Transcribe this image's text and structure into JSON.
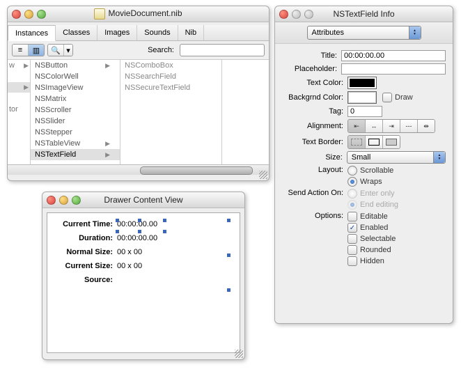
{
  "nib": {
    "title": "MovieDocument.nib",
    "tabs": [
      "Instances",
      "Classes",
      "Images",
      "Sounds",
      "Nib"
    ],
    "active_tab": 0,
    "search_label": "Search:",
    "col0": [
      "w",
      "",
      "",
      "tor",
      ""
    ],
    "col1": [
      {
        "label": "NSButton",
        "arrow": true
      },
      {
        "label": "NSColorWell",
        "arrow": false
      },
      {
        "label": "NSImageView",
        "arrow": false
      },
      {
        "label": "NSMatrix",
        "arrow": false
      },
      {
        "label": "NSScroller",
        "arrow": false
      },
      {
        "label": "NSSlider",
        "arrow": false
      },
      {
        "label": "NSStepper",
        "arrow": false
      },
      {
        "label": "NSTableView",
        "arrow": true
      },
      {
        "label": "NSTextField",
        "arrow": true
      }
    ],
    "col1_selected": 8,
    "col2": [
      "NSComboBox",
      "NSSearchField",
      "NSSecureTextField"
    ]
  },
  "drawer": {
    "title": "Drawer Content View",
    "rows": [
      {
        "label": "Current Time:",
        "value": "00:00:00.00"
      },
      {
        "label": "Duration:",
        "value": "00:00:00.00"
      },
      {
        "label": "Normal Size:",
        "value": "00 x 00"
      },
      {
        "label": "Current Size:",
        "value": "00 x 00"
      },
      {
        "label": "Source:",
        "value": ""
      }
    ]
  },
  "inspector": {
    "title": "NSTextField Info",
    "mode": "Attributes",
    "fields": {
      "title_label": "Title:",
      "title_value": "00:00:00.00",
      "placeholder_label": "Placeholder:",
      "placeholder_value": "",
      "textcolor_label": "Text Color:",
      "bgcolor_label": "Backgrnd Color:",
      "draw_label": "Draw",
      "tag_label": "Tag:",
      "tag_value": "0",
      "alignment_label": "Alignment:",
      "border_label": "Text Border:",
      "size_label": "Size:",
      "size_value": "Small",
      "layout_label": "Layout:",
      "layout_scrollable": "Scrollable",
      "layout_wraps": "Wraps",
      "sendaction_label": "Send Action On:",
      "sendaction_enter": "Enter only",
      "sendaction_end": "End editing",
      "options_label": "Options:",
      "opt_editable": "Editable",
      "opt_enabled": "Enabled",
      "opt_selectable": "Selectable",
      "opt_rounded": "Rounded",
      "opt_hidden": "Hidden"
    },
    "layout_selected": "wraps",
    "options_checked": {
      "editable": false,
      "enabled": true,
      "selectable": false,
      "rounded": false,
      "hidden": false
    }
  }
}
